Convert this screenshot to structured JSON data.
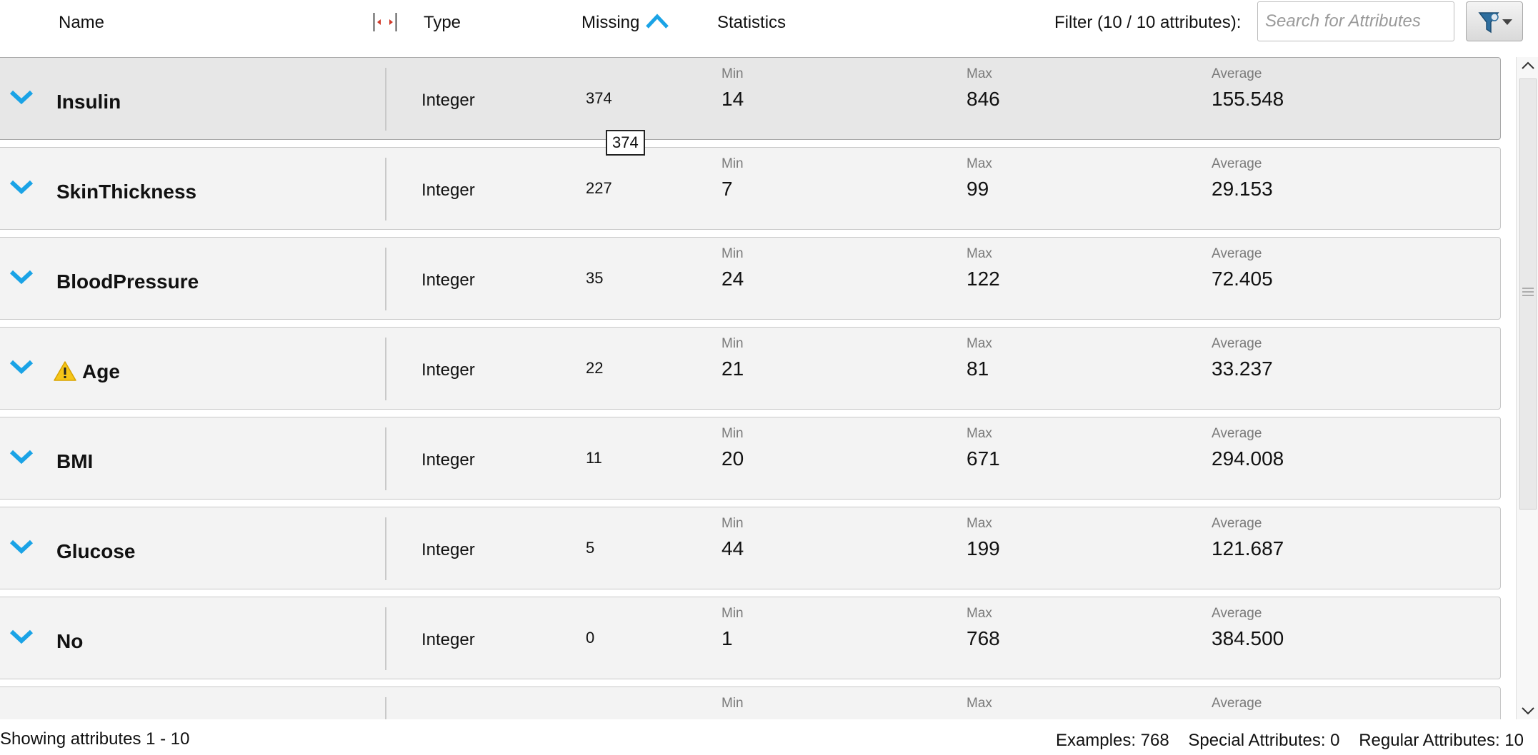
{
  "header": {
    "col_name": "Name",
    "col_type": "Type",
    "col_missing": "Missing",
    "col_statistics": "Statistics",
    "filter_label": "Filter (10 / 10 attributes):",
    "search_placeholder": "Search for Attributes",
    "sort_icon": "sort-ascending-icon",
    "filter_icon": "funnel-dropdown-icon"
  },
  "stat_labels": {
    "min": "Min",
    "max": "Max",
    "average": "Average"
  },
  "tooltip": "374",
  "rows": [
    {
      "name": "Insulin",
      "type": "Integer",
      "missing": "374",
      "min": "14",
      "max": "846",
      "average": "155.548",
      "selected": true
    },
    {
      "name": "SkinThickness",
      "type": "Integer",
      "missing": "227",
      "min": "7",
      "max": "99",
      "average": "29.153"
    },
    {
      "name": "BloodPressure",
      "type": "Integer",
      "missing": "35",
      "min": "24",
      "max": "122",
      "average": "72.405"
    },
    {
      "name": "Age",
      "type": "Integer",
      "missing": "22",
      "min": "21",
      "max": "81",
      "average": "33.237",
      "warning": true
    },
    {
      "name": "BMI",
      "type": "Integer",
      "missing": "11",
      "min": "20",
      "max": "671",
      "average": "294.008"
    },
    {
      "name": "Glucose",
      "type": "Integer",
      "missing": "5",
      "min": "44",
      "max": "199",
      "average": "121.687"
    },
    {
      "name": "No",
      "type": "Integer",
      "missing": "0",
      "min": "1",
      "max": "768",
      "average": "384.500"
    }
  ],
  "colors": {
    "accent": "#1aa3e6",
    "warning": "#f5c518"
  },
  "footer": {
    "showing": "Showing attributes 1 - 10",
    "examples": "Examples: 768",
    "special": "Special Attributes: 0",
    "regular": "Regular Attributes: 10"
  }
}
